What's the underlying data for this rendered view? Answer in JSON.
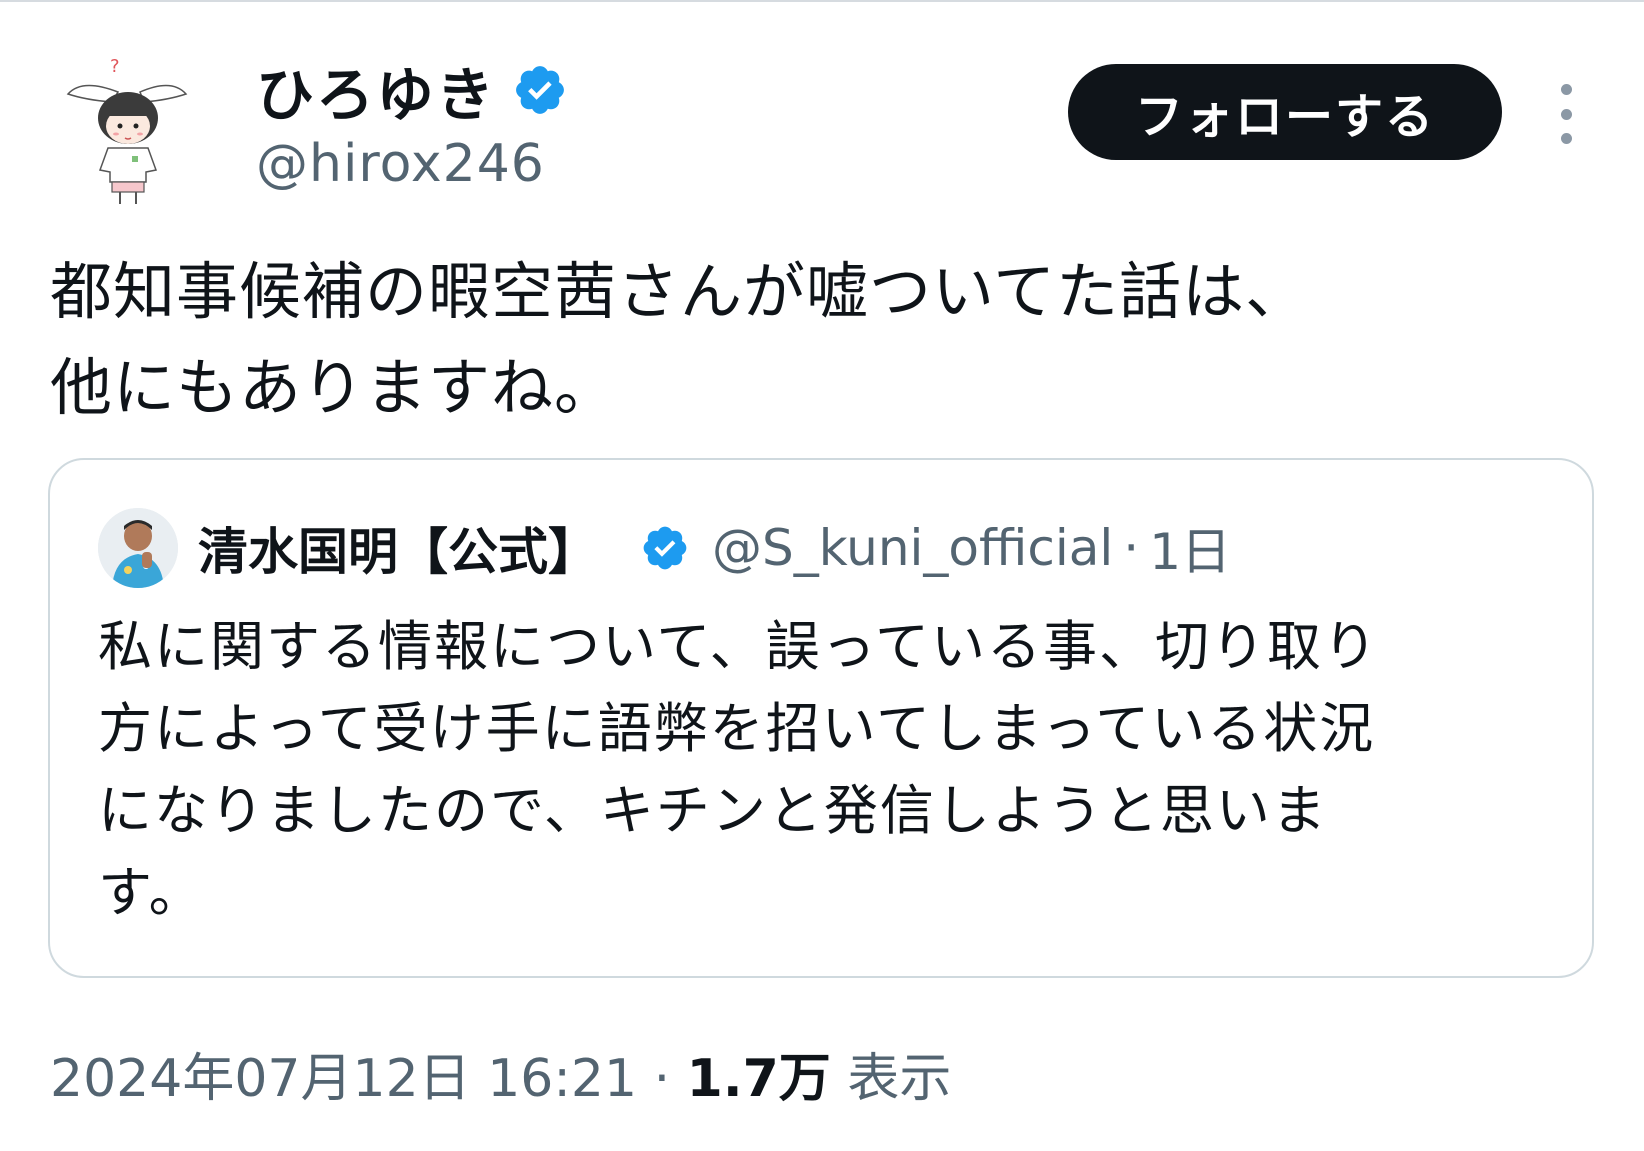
{
  "author": {
    "name": "ひろゆき",
    "handle": "@hirox246",
    "verified": true
  },
  "follow_button": {
    "label": "フォローする"
  },
  "tweet": {
    "text_lines": [
      "都知事候補の暇空茜さんが嘘ついてた話は、",
      "他にもありますね。"
    ]
  },
  "quoted_tweet": {
    "name": "清水国明【公式】",
    "handle": "@S_kuni_official",
    "separator": "·",
    "time": "1日",
    "verified": true,
    "text_lines": [
      "私に関する情報について、誤っている事、切り取り",
      "方によって受け手に語弊を招いてしまっている状況",
      "になりましたので、キチンと発信しようと思いま",
      "す。"
    ]
  },
  "meta": {
    "timestamp": "2024年07月12日 16:21",
    "separator": "·",
    "views_count": "1.7万",
    "views_label": "表示"
  },
  "colors": {
    "verified_blue": "#1d9bf0",
    "text_primary": "#0f1419",
    "text_secondary": "#536471",
    "border": "#cfd9de",
    "button_bg": "#0f1419"
  }
}
